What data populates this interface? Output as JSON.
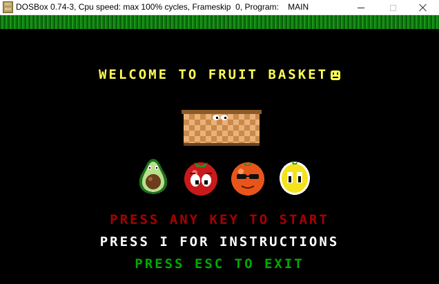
{
  "window": {
    "title": "DOSBox 0.74-3, Cpu speed: max 100% cycles, Frameskip  0, Program:    MAIN",
    "icon": "dosbox-icon",
    "icon_text": "DOS BOX"
  },
  "game": {
    "welcome": "WELCOME TO FRUIT BASKET",
    "start_prompt": "PRESS ANY KEY TO START",
    "instructions_prompt": "PRESS I FOR INSTRUCTIONS",
    "exit_prompt": "PRESS ESC TO EXIT",
    "characters": [
      "avocado",
      "tomato",
      "orange",
      "lemon"
    ],
    "colors": {
      "welcome": "#ffff55",
      "start": "#aa0000",
      "instructions": "#ffffff",
      "exit": "#00aa00",
      "grass": "#0f7a0f"
    }
  }
}
